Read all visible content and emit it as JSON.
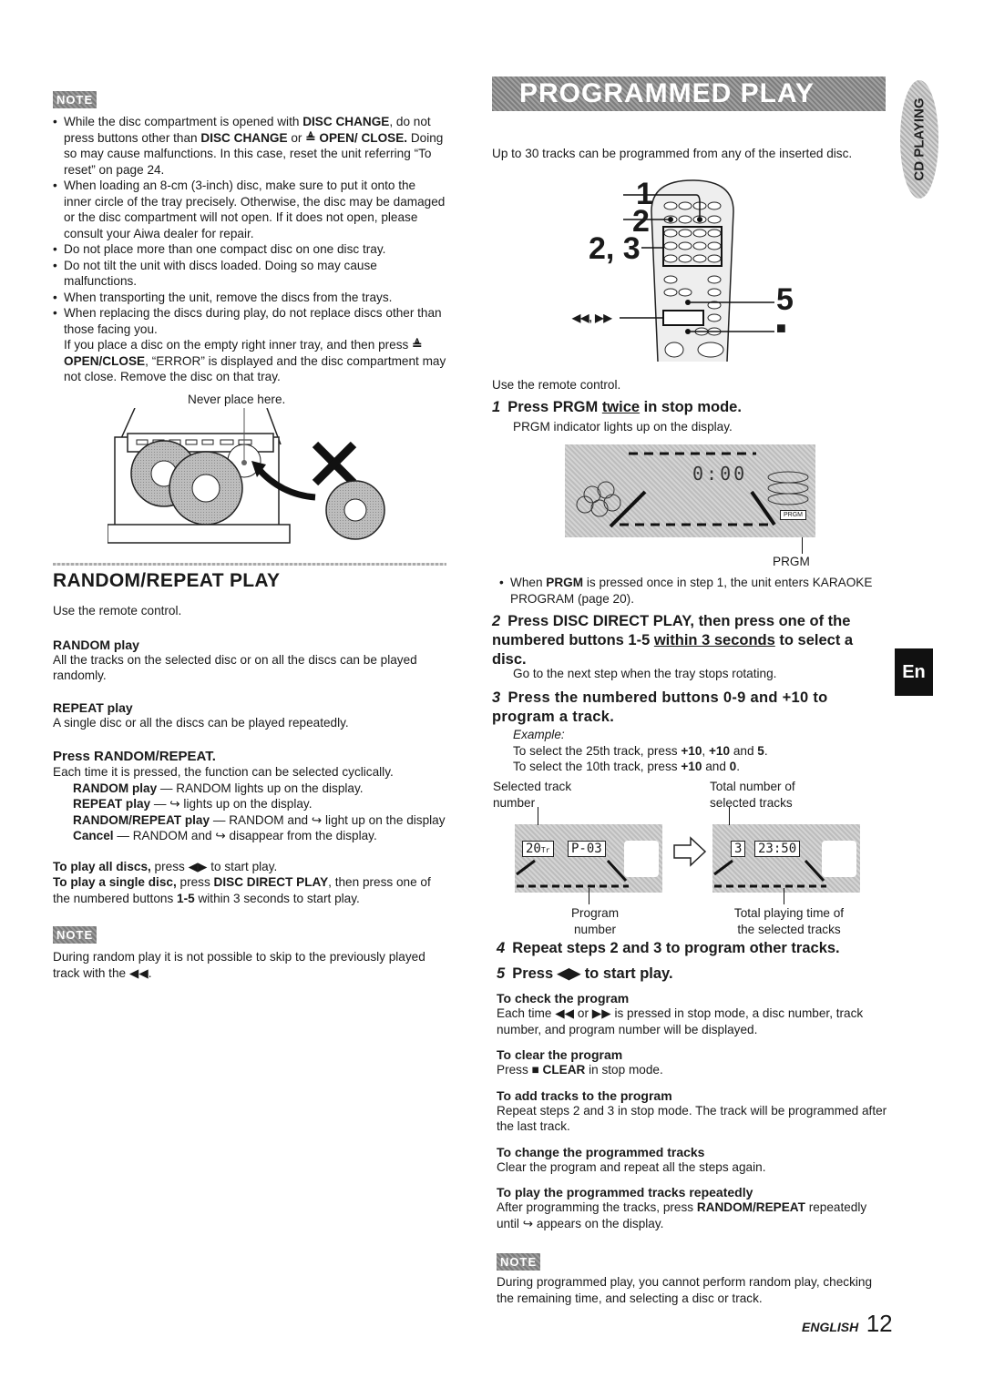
{
  "left": {
    "note1": {
      "badge": "NOTE",
      "items": [
        {
          "pre": "While the disc compartment is opened with ",
          "b1": "DISC CHANGE",
          "mid": ", do not press buttons other than ",
          "b2": "DISC CHANGE",
          "mid2": " or ",
          "b3": "≜ OPEN/ CLOSE.",
          "post": " Doing so may cause malfunctions. In this case, reset the unit referring “To reset” on page 24."
        },
        {
          "text": "When loading an 8-cm (3-inch) disc, make sure to put it onto the inner circle of the tray precisely. Otherwise, the disc may be damaged or the disc compartment will not open. If it does not open, please consult your Aiwa dealer for repair."
        },
        {
          "text": "Do not place more than one compact disc on one disc tray."
        },
        {
          "text": "Do not tilt the unit with discs loaded. Doing so may cause malfunctions."
        },
        {
          "text": "When transporting the unit, remove the discs from the trays."
        },
        {
          "text": "When replacing the discs during play, do not replace discs other than those facing you."
        }
      ],
      "extra_pre": "If you place a disc on the empty right inner tray, and then press ",
      "extra_bold": "≜ OPEN/CLOSE",
      "extra_post": ", “ERROR” is displayed and the disc compartment may not close. Remove the disc on that tray."
    },
    "figure_caption": "Never place here.",
    "random_repeat": {
      "title": "RANDOM/REPEAT PLAY",
      "intro": "Use the remote control.",
      "random_heading": "RANDOM play",
      "random_text": "All the tracks on the selected disc or on all the discs can be played randomly.",
      "repeat_heading": "REPEAT play",
      "repeat_text": "A single disc or all the discs can be played repeatedly.",
      "press_heading": "Press RANDOM/REPEAT.",
      "press_text": "Each time it is pressed, the function can be selected cyclically.",
      "modes": [
        {
          "b": "RANDOM play",
          "t": " — RANDOM lights up on the display."
        },
        {
          "b": "REPEAT play",
          "t": " — ↪ lights up on the display."
        },
        {
          "b": "RANDOM/REPEAT play",
          "t": " — RANDOM and ↪ light up on the display"
        },
        {
          "b": "Cancel",
          "t": " — RANDOM and ↪ disappear from the display."
        }
      ],
      "all_b": "To play all discs,",
      "all_t": " press ◀▶ to start play.",
      "single_b": "To play a single disc,",
      "single_t1": " press ",
      "single_b2": "DISC DIRECT PLAY",
      "single_t2": ", then press one of the numbered buttons ",
      "single_b3": "1-5",
      "single_t3": " within 3 seconds to start play."
    },
    "note2": {
      "badge": "NOTE",
      "text": "During random play it is not possible to skip to the previously played track with the ◀◀."
    }
  },
  "right": {
    "banner": "PROGRAMMED PLAY",
    "side_tab": "CD PLAYING",
    "intro": "Up to 30 tracks can be programmed from any of the inserted disc.",
    "remote_labels": [
      "1",
      "2",
      "2, 3",
      "5",
      "■",
      "◀◀, ▶▶"
    ],
    "use_remote": "Use the remote control.",
    "step1": {
      "n": "1",
      "pre": "Press PRGM ",
      "u": "twice",
      "post": " in stop mode.",
      "sub": "PRGM indicator lights up on the display."
    },
    "lcd1": {
      "time": "0:00",
      "indicator": "PRGM",
      "callout": "PRGM"
    },
    "step1_note_pre": "When ",
    "step1_note_b": "PRGM",
    "step1_note_post": " is pressed once in step 1, the unit enters KARAOKE PROGRAM (page 20).",
    "step2": {
      "n": "2",
      "pre": "Press DISC DIRECT PLAY, then press one of the numbered buttons 1-5 ",
      "u": "within 3 seconds",
      "post": " to select a disc.",
      "sub": "Go to the next step when the tray stops rotating."
    },
    "step3": {
      "n": "3",
      "text": "Press the numbered buttons 0-9 and +10 to program a track.",
      "example": "Example:",
      "ex1_pre": "To select the 25th track, press ",
      "ex1_b": "+10",
      "ex1_m": ", ",
      "ex1_b2": "+10",
      "ex1_m2": " and ",
      "ex1_b3": "5",
      "ex1_end": ".",
      "ex2_pre": "To select the 10th track, press ",
      "ex2_b": "+10",
      "ex2_m": " and ",
      "ex2_b2": "0",
      "ex2_end": "."
    },
    "lcd2": {
      "label_track": "Selected track number",
      "label_total": "Total number of selected tracks",
      "track": "20",
      "track_suffix": "Tr",
      "program": "P-03",
      "count": "3",
      "time": "23:50",
      "label_program": "Program number",
      "label_time": "Total playing time of the selected tracks"
    },
    "en_tab": "En",
    "step4": {
      "n": "4",
      "text": "Repeat steps 2 and 3 to program other tracks."
    },
    "step5": {
      "n": "5",
      "text": "Press ◀▶ to start play."
    },
    "subsections": [
      {
        "h": "To check the program",
        "t": "Each time ◀◀ or ▶▶ is pressed in stop mode, a disc number, track number, and program number will be displayed."
      },
      {
        "h": "To clear the program",
        "t_pre": "Press ",
        "t_b": "■ CLEAR",
        "t_post": " in stop mode."
      },
      {
        "h": "To add tracks to the program",
        "t": "Repeat steps 2 and 3 in stop mode. The track will be programmed after the last track."
      },
      {
        "h": "To change the programmed tracks",
        "t": "Clear the program and repeat all the steps again."
      },
      {
        "h": "To play the programmed tracks repeatedly",
        "t_pre": "After programming the tracks, press ",
        "t_b": "RANDOM/REPEAT",
        "t_post": " repeatedly until ↪ appears on the display."
      }
    ],
    "note": {
      "badge": "NOTE",
      "text": "During programmed play, you cannot perform random play, checking the remaining time, and selecting a disc or track."
    },
    "footer": {
      "lang": "ENGLISH",
      "page": "12"
    }
  }
}
